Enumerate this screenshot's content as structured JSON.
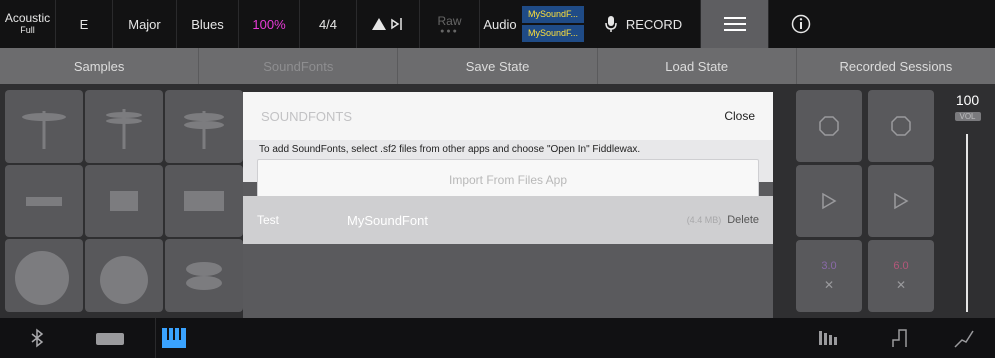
{
  "topbar": {
    "instrument": {
      "line1": "Acoustic",
      "line2": "Full"
    },
    "key": "E",
    "scale": "Major",
    "style": "Blues",
    "percent": "100%",
    "time_signature": "4/4",
    "raw_label": "Raw",
    "audio_label": "Audio",
    "soundfont": {
      "line1": "MySoundF...",
      "line2": "MySoundF..."
    },
    "record_label": "RECORD",
    "accent_magenta": "#e83bd8",
    "soundfont_text_color": "#ffe13b",
    "soundfont_bg_color": "#1f4b86"
  },
  "tabs": [
    {
      "label": "Samples"
    },
    {
      "label": "SoundFonts"
    },
    {
      "label": "Save State"
    },
    {
      "label": "Load State"
    },
    {
      "label": "Recorded Sessions"
    }
  ],
  "volume": {
    "value": "100",
    "label": "VOL"
  },
  "right_controls": [
    {
      "ratio": "3.0"
    },
    {
      "ratio": "6.0"
    }
  ],
  "modal": {
    "title": "SOUNDFONTS",
    "close_label": "Close",
    "info": "To add SoundFonts, select .sf2 files from other apps and choose \"Open In\" Fiddlewax.",
    "import_label": "Import From Files App",
    "rows": [
      {
        "left": "Test",
        "name": "MySoundFont",
        "size": "(4.4 MB)",
        "delete_label": "Delete"
      }
    ]
  }
}
